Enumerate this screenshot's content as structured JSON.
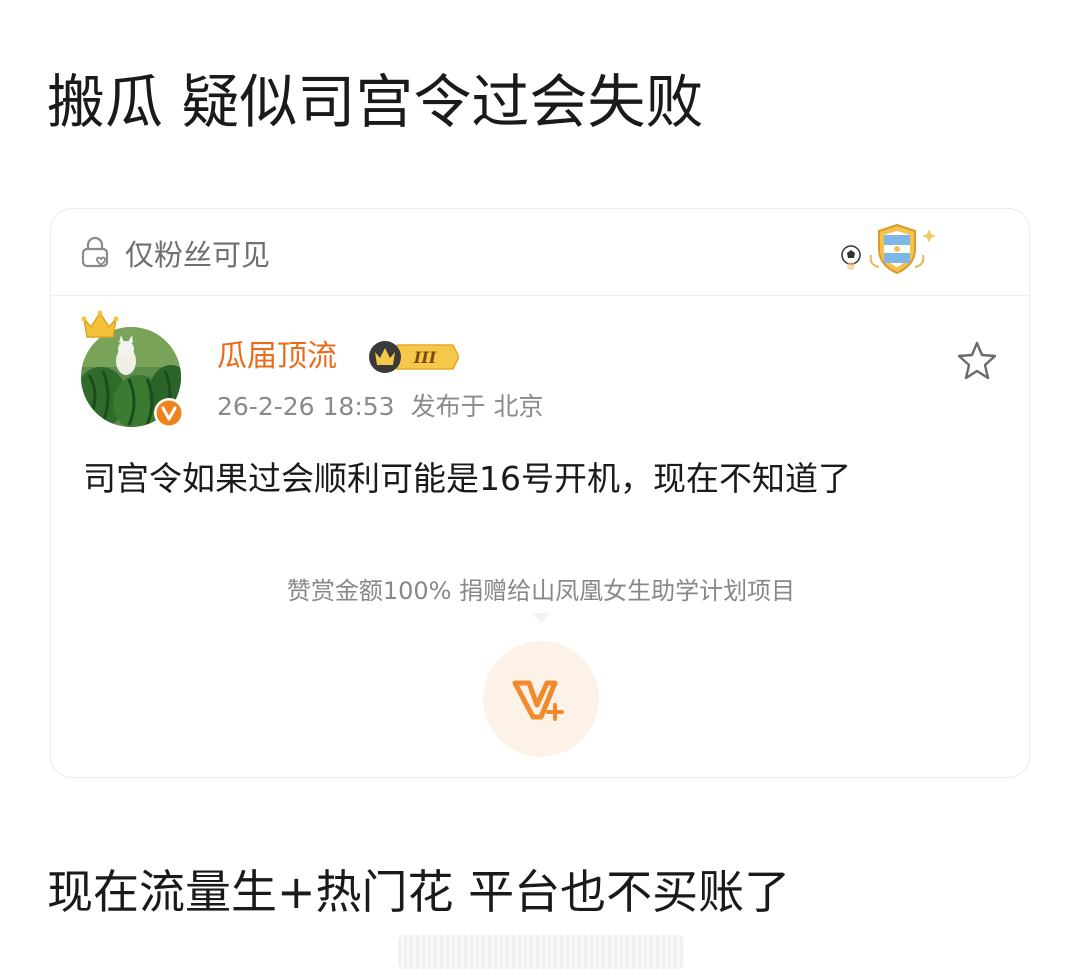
{
  "title": "搬瓜 疑似司宫令过会失败",
  "card": {
    "visibility": "仅粉丝可见",
    "author": {
      "name": "瓜届顶流",
      "level": "III"
    },
    "meta": {
      "time": "26-2-26 18:53",
      "location": "发布于 北京"
    },
    "text": "司宫令如果过会顺利可能是16号开机，现在不知道了",
    "reward": {
      "text": "赞赏金额100% 捐赠给山凤凰女生助学计划项目"
    }
  },
  "bottom_title": "现在流量生+热门花 平台也不买账了",
  "colors": {
    "accent": "#e96c1c",
    "text": "#1a1a1a",
    "muted": "#8a8a8a"
  }
}
